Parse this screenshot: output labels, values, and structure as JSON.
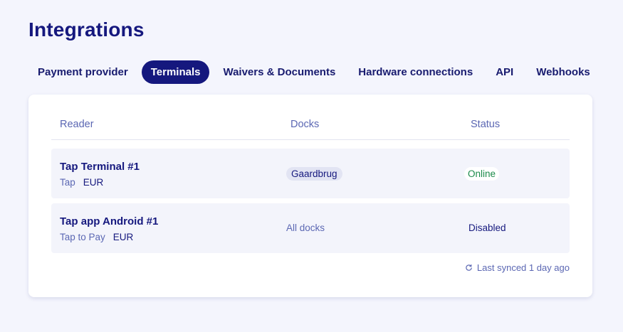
{
  "page": {
    "title": "Integrations"
  },
  "tabs": [
    {
      "label": "Payment provider",
      "active": false
    },
    {
      "label": "Terminals",
      "active": true
    },
    {
      "label": "Waivers & Documents",
      "active": false
    },
    {
      "label": "Hardware connections",
      "active": false
    },
    {
      "label": "API",
      "active": false
    },
    {
      "label": "Webhooks",
      "active": false
    }
  ],
  "table": {
    "headers": {
      "reader": "Reader",
      "docks": "Docks",
      "status": "Status"
    },
    "rows": [
      {
        "name": "Tap Terminal #1",
        "type": "Tap",
        "currency": "EUR",
        "docks": "Gaardbrug",
        "status": "Online"
      },
      {
        "name": "Tap app Android #1",
        "type": "Tap to Pay",
        "currency": "EUR",
        "docks": "All docks",
        "status": "Disabled"
      }
    ],
    "sync": {
      "text": "Last synced 1 day ago",
      "icon": "refresh-icon"
    }
  },
  "colors": {
    "background": "#f4f5fd",
    "primary": "#15187e",
    "muted": "#5b67b3",
    "online": "#1b8a4a"
  }
}
